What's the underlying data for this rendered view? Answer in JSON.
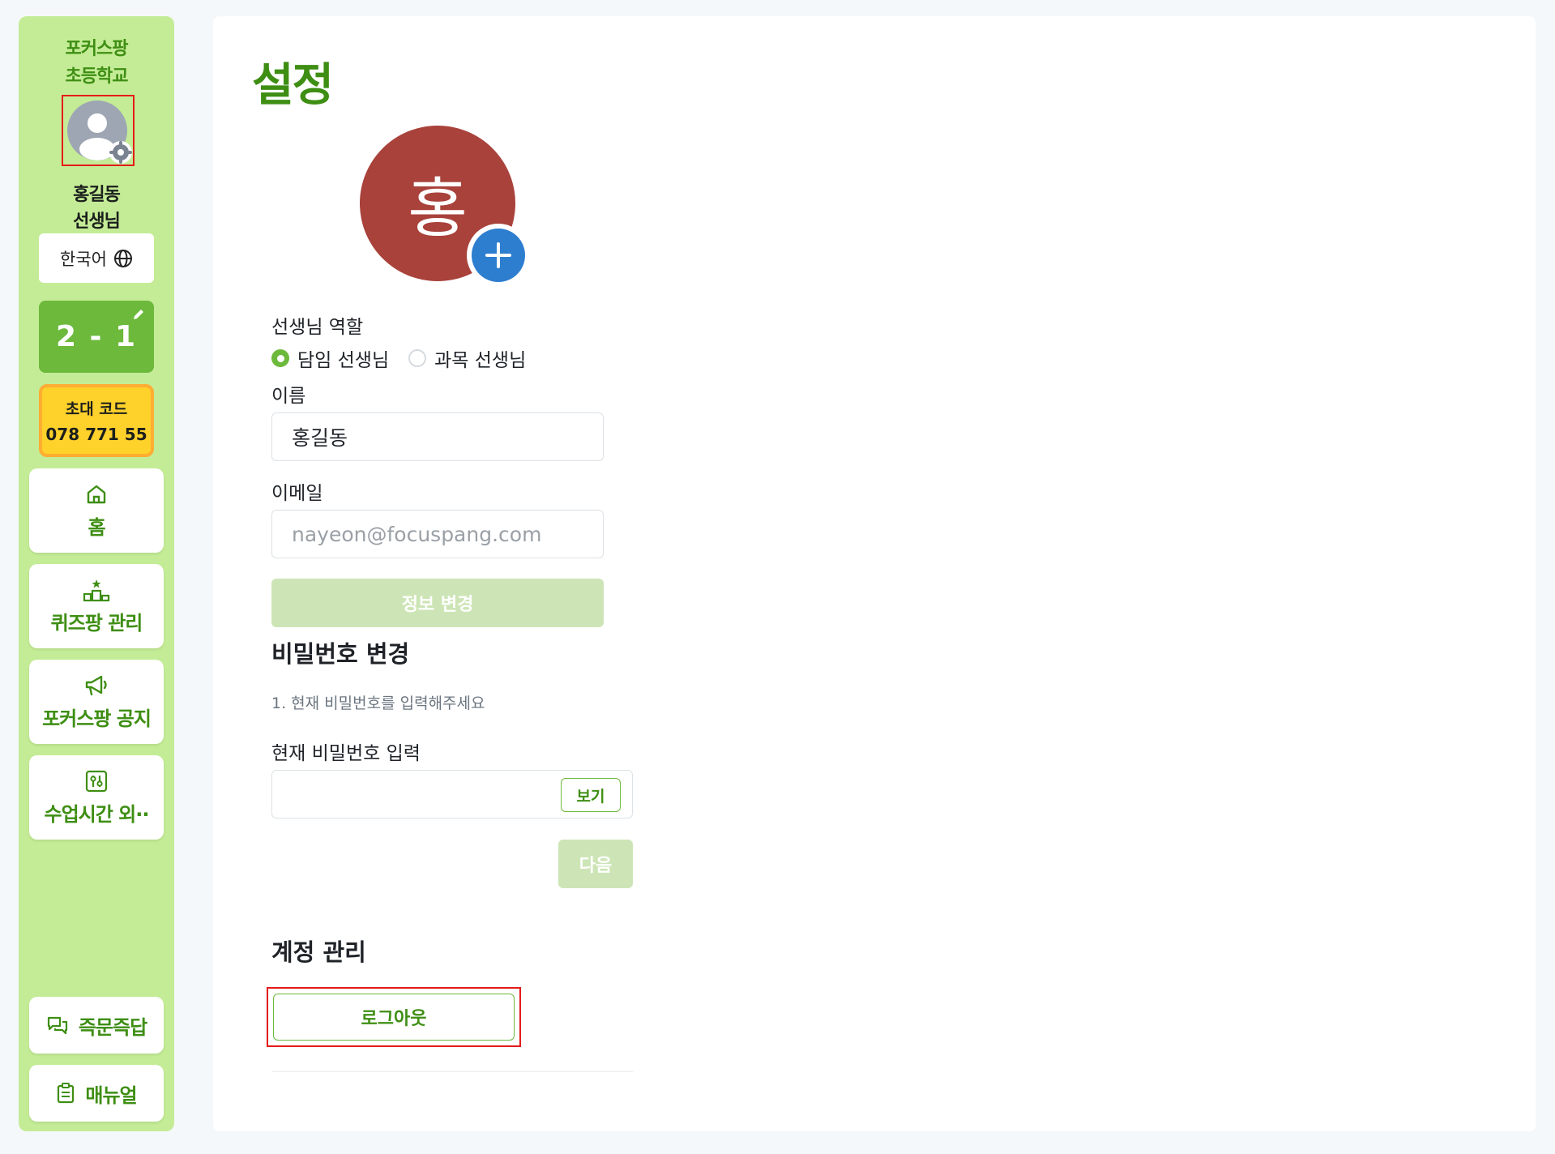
{
  "sidebar": {
    "school_line1": "포커스팡",
    "school_line2": "초등학교",
    "teacher_line1": "홍길동",
    "teacher_line2": "선생님",
    "language": "한국어",
    "class_name": "2 - 1",
    "invite_label": "초대 코드",
    "invite_code": "078 771 55",
    "nav": {
      "home": "홈",
      "quiz": "퀴즈팡 관리",
      "notice": "포커스팡 공지",
      "schedule": "수업시간 외··"
    },
    "qna": "즉문즉답",
    "manual": "매뉴얼"
  },
  "main": {
    "title": "설정",
    "profile_initial": "홍",
    "role_label": "선생님 역할",
    "role_options": [
      "담임 선생님",
      "과목 선생님"
    ],
    "role_selected": "담임 선생님",
    "name_label": "이름",
    "name_value": "홍길동",
    "email_label": "이메일",
    "email_placeholder": "nayeon@focuspang.com",
    "update_button": "정보 변경",
    "password_section_title": "비밀번호 변경",
    "password_hint": "1. 현재 비밀번호를 입력해주세요",
    "current_password_label": "현재 비밀번호 입력",
    "show_button": "보기",
    "next_button": "다음",
    "account_section_title": "계정 관리",
    "logout_button": "로그아웃"
  },
  "colors": {
    "brand_green": "#3e8e13",
    "sidebar_bg": "#c4ec96",
    "class_card": "#6cb93c",
    "invite_bg": "#ffd12b",
    "profile_bg": "#a8423b",
    "add_button": "#2d7ecf",
    "disabled_button": "#cde5b6",
    "highlight_border": "#e41b1b"
  }
}
